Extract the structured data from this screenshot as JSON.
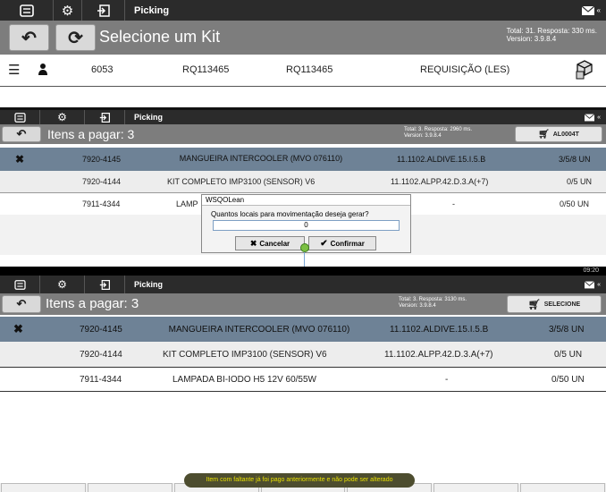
{
  "app": {
    "title": "Picking"
  },
  "panel1": {
    "header": "Selecione um Kit",
    "status_total": "Total: 31. Resposta: 330 ms.",
    "status_version": "Version: 3.9.8.4",
    "row": {
      "number": "6053",
      "code1": "RQ113465",
      "code2": "RQ113465",
      "type": "REQUISIÇÃO (LES)"
    }
  },
  "panel2": {
    "header": "Itens a pagar: 3",
    "status_total": "Total: 3. Resposta: 2960 ms.",
    "status_version": "Version: 3.9.8.4",
    "cart_label": "AL0004T",
    "rows": [
      {
        "code": "7920-4145",
        "desc": "MANGUEIRA INTERCOOLER (MVO 076110)",
        "loc": "11.1102.ALDIVE.15.I.5.B",
        "qty": "3/5/8 UN"
      },
      {
        "code": "7920-4144",
        "desc": "KIT COMPLETO IMP3100 (SENSOR) V6",
        "loc": "11.1102.ALPP.42.D.3.A(+7)",
        "qty": "0/5 UN"
      },
      {
        "code": "7911-4344",
        "desc": "LAMP",
        "loc": "-",
        "qty": "0/50 UN"
      }
    ],
    "dialog": {
      "title": "WSQOLean",
      "question": "Quantos locais para movimentação deseja gerar?",
      "value": "0",
      "cancel": "Cancelar",
      "confirm": "Confirmar"
    }
  },
  "panel3": {
    "clock": "09:20",
    "header": "Itens a pagar: 3",
    "status_total": "Total: 3. Resposta: 3130 ms.",
    "status_version": "Version: 3.9.8.4",
    "cart_label": "SELECIONE",
    "rows": [
      {
        "code": "7920-4145",
        "desc": "MANGUEIRA INTERCOOLER (MVO 076110)",
        "loc": "11.1102.ALDIVE.15.I.5.B",
        "qty": "3/5/8 UN"
      },
      {
        "code": "7920-4144",
        "desc": "KIT COMPLETO IMP3100 (SENSOR) V6",
        "loc": "11.1102.ALPP.42.D.3.A(+7)",
        "qty": "0/5 UN"
      },
      {
        "code": "7911-4344",
        "desc": "LAMPADA BI-IODO H5 12V 60/55W",
        "loc": "-",
        "qty": "0/50 UN"
      }
    ],
    "toast": "Item com faltante já foi pago anteriormente e não pode ser alterado"
  },
  "icons": [
    "menu-icon",
    "settings-gear-icon",
    "logout-icon",
    "mail-icon",
    "back-arrow-icon",
    "refresh-icon",
    "list-icon",
    "user-icon",
    "boxes-icon",
    "close-x-icon",
    "cart-icon",
    "check-icon"
  ]
}
